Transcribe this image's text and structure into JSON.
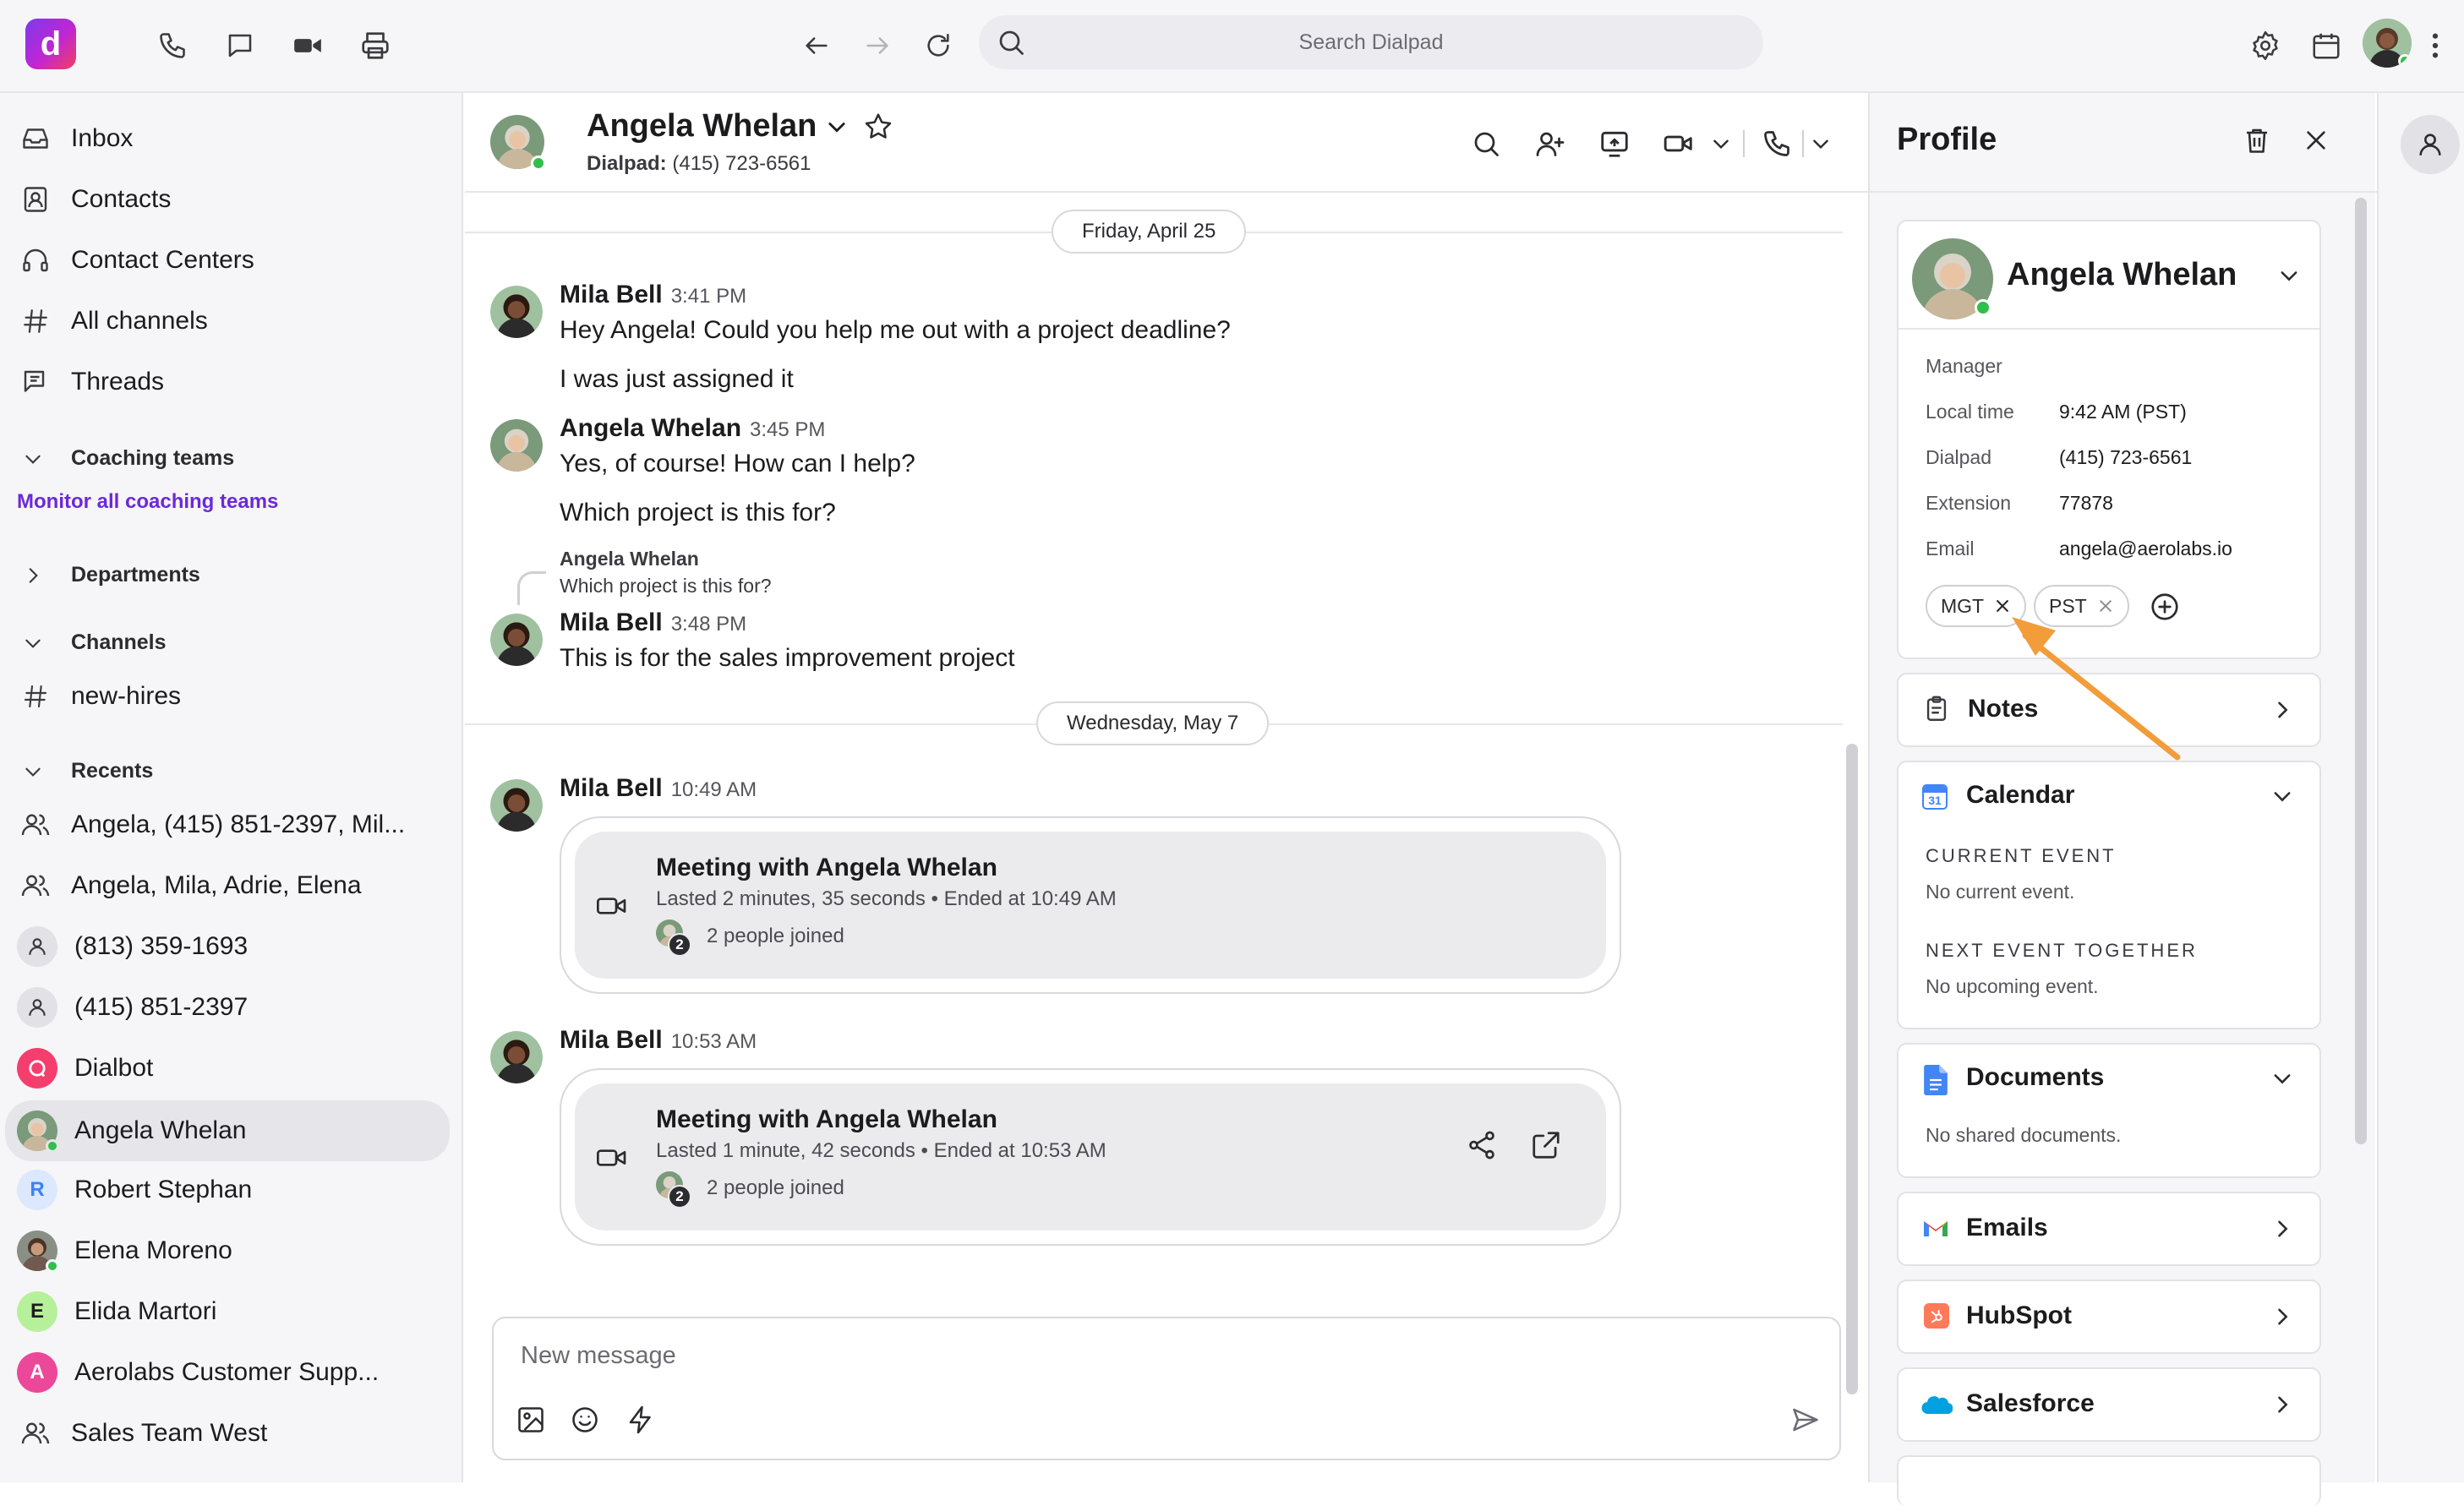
{
  "topbar": {
    "logo_letter": "d",
    "search_placeholder": "Search Dialpad"
  },
  "sidebar": {
    "nav": [
      "Inbox",
      "Contacts",
      "Contact Centers",
      "All channels",
      "Threads"
    ],
    "coaching_label": "Coaching teams",
    "monitor_link": "Monitor all coaching teams",
    "departments_label": "Departments",
    "channels_label": "Channels",
    "channel": "new-hires",
    "recents_label": "Recents",
    "recents": [
      {
        "label": "Angela, (415) 851-2397, Mil...",
        "kind": "group"
      },
      {
        "label": "Angela, Mila, Adrie, Elena",
        "kind": "group"
      },
      {
        "label": "(813) 359-1693",
        "kind": "person"
      },
      {
        "label": "(415) 851-2397",
        "kind": "person"
      },
      {
        "label": "Dialbot",
        "kind": "bot"
      },
      {
        "label": "Angela Whelan",
        "kind": "photo",
        "selected": true
      },
      {
        "label": "Robert Stephan",
        "kind": "initial",
        "initial": "R",
        "color": "#3b82f6",
        "bg": "#dbe8fd"
      },
      {
        "label": "Elena Moreno",
        "kind": "photo"
      },
      {
        "label": "Elida Martori",
        "kind": "initial",
        "initial": "E",
        "color": "#1c1c1e",
        "bg": "#b7f09a"
      },
      {
        "label": "Aerolabs Customer Supp...",
        "kind": "initial",
        "initial": "A",
        "color": "#ffffff",
        "bg": "#ec4899"
      },
      {
        "label": "Sales Team West",
        "kind": "group"
      }
    ]
  },
  "chat": {
    "contact_name": "Angela Whelan",
    "contact_line_label": "Dialpad:",
    "contact_line_value": "(415) 723-6561",
    "date1": "Friday, April 25",
    "date2": "Wednesday, May 7",
    "messages": [
      {
        "name": "Mila Bell",
        "time": "3:41 PM",
        "lines": [
          "Hey Angela! Could you help me out with a project deadline?",
          "I was just assigned it"
        ]
      },
      {
        "name": "Angela Whelan",
        "time": "3:45 PM",
        "lines": [
          "Yes, of course! How can I help?",
          "Which project is this for?"
        ]
      },
      {
        "name": "Mila Bell",
        "time": "3:48 PM",
        "lines": [
          "This is for the sales improvement project"
        ]
      }
    ],
    "reply_quote_name": "Angela Whelan",
    "reply_quote_text": "Which project is this for?",
    "meeting1": {
      "name": "Mila Bell",
      "time": "10:49 AM",
      "title": "Meeting with Angela Whelan",
      "sub": "Lasted 2 minutes, 35 seconds • Ended at 10:49 AM",
      "joined": "2 people joined",
      "count": "2"
    },
    "meeting2": {
      "name": "Mila Bell",
      "time": "10:53 AM",
      "title": "Meeting with Angela Whelan",
      "sub": "Lasted 1 minute, 42 seconds • Ended at 10:53 AM",
      "joined": "2 people joined",
      "count": "2"
    },
    "composer_placeholder": "New message"
  },
  "profile": {
    "title": "Profile",
    "name": "Angela Whelan",
    "role": "Manager",
    "fields": [
      {
        "label": "Local time",
        "value": "9:42 AM (PST)"
      },
      {
        "label": "Dialpad",
        "value": "(415) 723-6561"
      },
      {
        "label": "Extension",
        "value": "77878"
      },
      {
        "label": "Email",
        "value": "angela@aerolabs.io"
      }
    ],
    "tags": [
      "MGT",
      "PST"
    ],
    "notes": "Notes",
    "calendar": "Calendar",
    "current_event_cap": "CURRENT EVENT",
    "current_event_val": "No current event.",
    "next_event_cap": "NEXT EVENT TOGETHER",
    "next_event_val": "No upcoming event.",
    "documents": "Documents",
    "documents_val": "No shared documents.",
    "emails": "Emails",
    "hubspot": "HubSpot",
    "salesforce": "Salesforce",
    "annotation_color": "#f39c3a"
  }
}
